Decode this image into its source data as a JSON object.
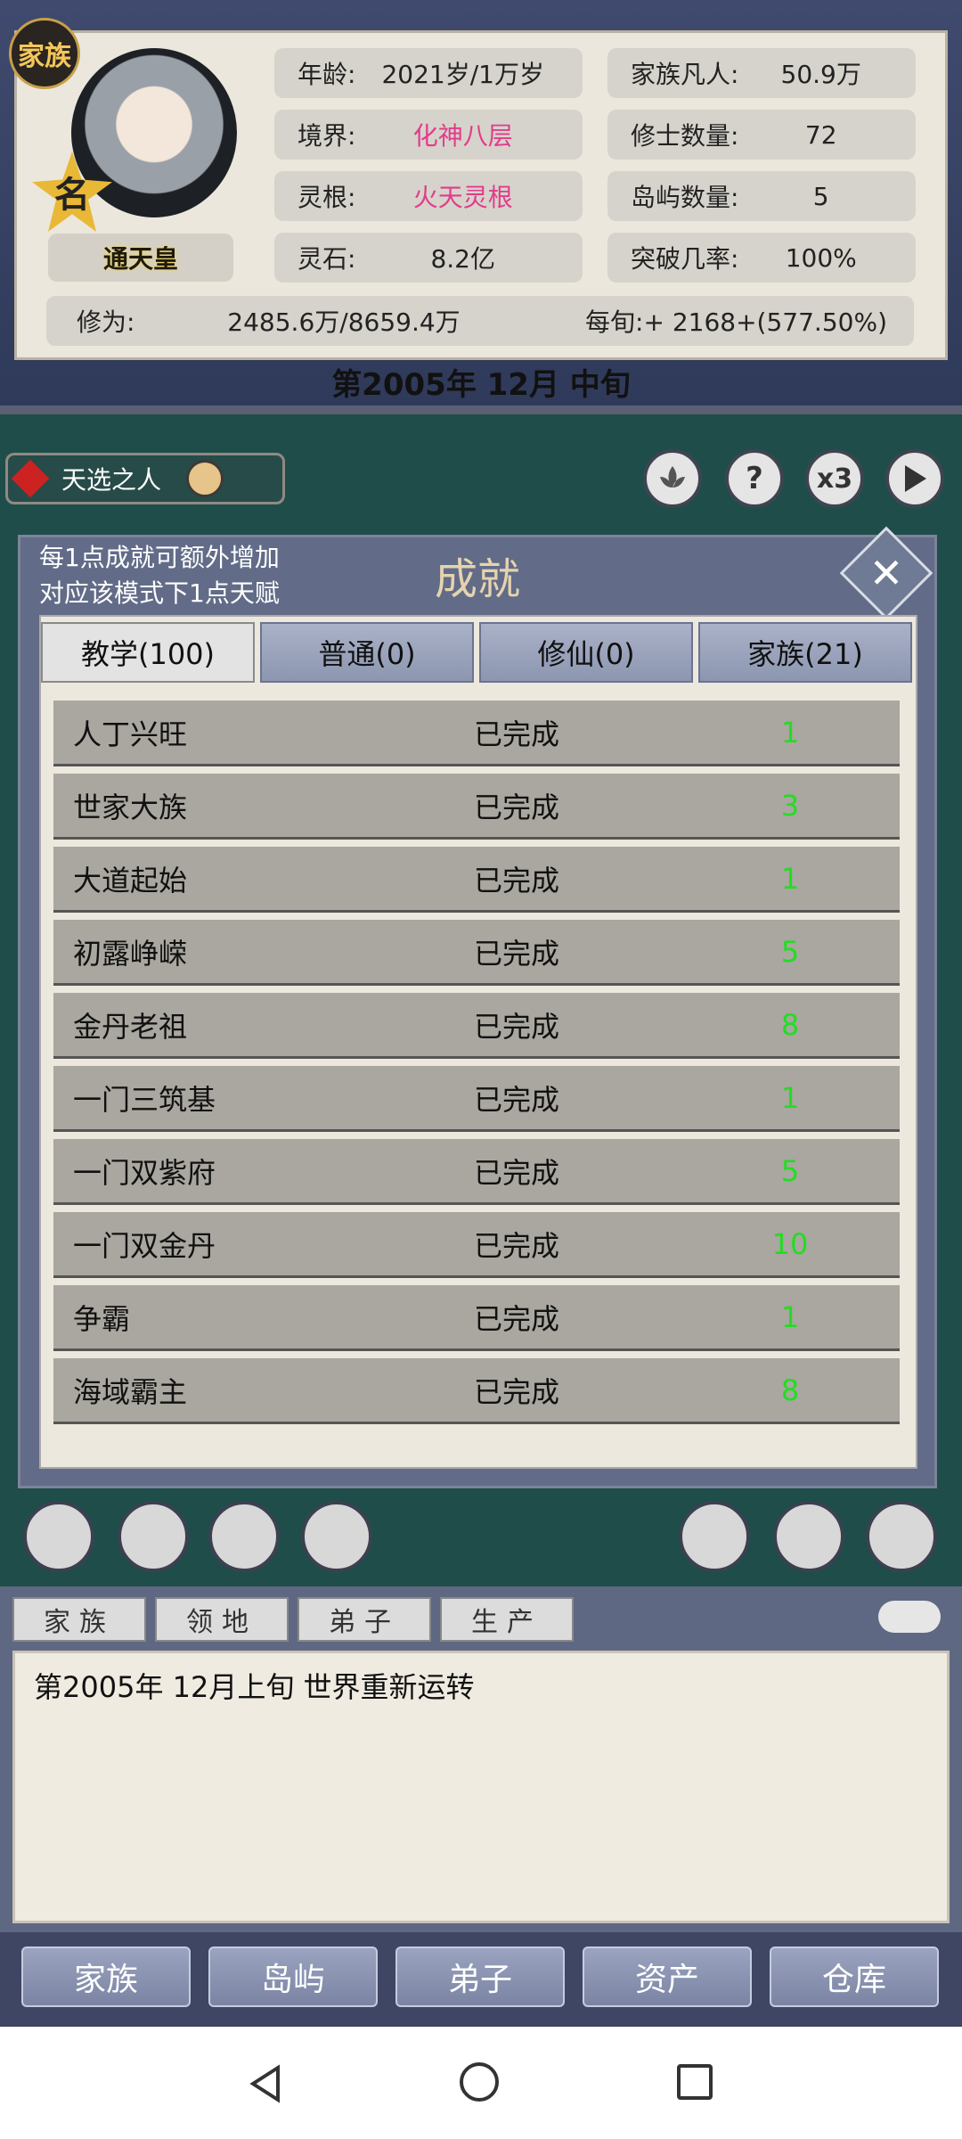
{
  "header": {
    "family_badge": "家族",
    "title_badge": "名",
    "character_title": "通天皇",
    "stats": [
      {
        "key": "年龄:",
        "value": "2021岁/1万岁"
      },
      {
        "key": "境界:",
        "value": "化神八层"
      },
      {
        "key": "灵根:",
        "value": "火天灵根"
      },
      {
        "key": "灵石:",
        "value": "8.2亿"
      },
      {
        "key": "家族凡人:",
        "value": "50.9万"
      },
      {
        "key": "修士数量:",
        "value": "72"
      },
      {
        "key": "岛屿数量:",
        "value": "5"
      },
      {
        "key": "突破几率:",
        "value": "100%"
      }
    ],
    "cultivation_label": "修为:",
    "cultivation_value": "2485.6万/8659.4万",
    "per_period": "每旬:+ 2168+(577.50%)",
    "date": "第2005年 12月 中旬"
  },
  "chosen": {
    "label": "天选之人"
  },
  "controls": {
    "speed": "x3",
    "help": "?"
  },
  "achievements": {
    "note_line1": "每1点成就可额外增加",
    "note_line2": "对应该模式下1点天赋",
    "title": "成就",
    "tabs": [
      "教学(100)",
      "普通(0)",
      "修仙(0)",
      "家族(21)"
    ],
    "rows": [
      {
        "name": "人丁兴旺",
        "status": "已完成",
        "points": "1"
      },
      {
        "name": "世家大族",
        "status": "已完成",
        "points": "3"
      },
      {
        "name": "大道起始",
        "status": "已完成",
        "points": "1"
      },
      {
        "name": "初露峥嵘",
        "status": "已完成",
        "points": "5"
      },
      {
        "name": "金丹老祖",
        "status": "已完成",
        "points": "8"
      },
      {
        "name": "一门三筑基",
        "status": "已完成",
        "points": "1"
      },
      {
        "name": "一门双紫府",
        "status": "已完成",
        "points": "5"
      },
      {
        "name": "一门双金丹",
        "status": "已完成",
        "points": "10"
      },
      {
        "name": "争霸",
        "status": "已完成",
        "points": "1"
      },
      {
        "name": "海域霸主",
        "status": "已完成",
        "points": "8"
      }
    ]
  },
  "log": {
    "tabs": [
      "家族",
      "领地",
      "弟子",
      "生产"
    ],
    "text": "第2005年 12月上旬 世界重新运转"
  },
  "nav": [
    "家族",
    "岛屿",
    "弟子",
    "资产",
    "仓库"
  ]
}
